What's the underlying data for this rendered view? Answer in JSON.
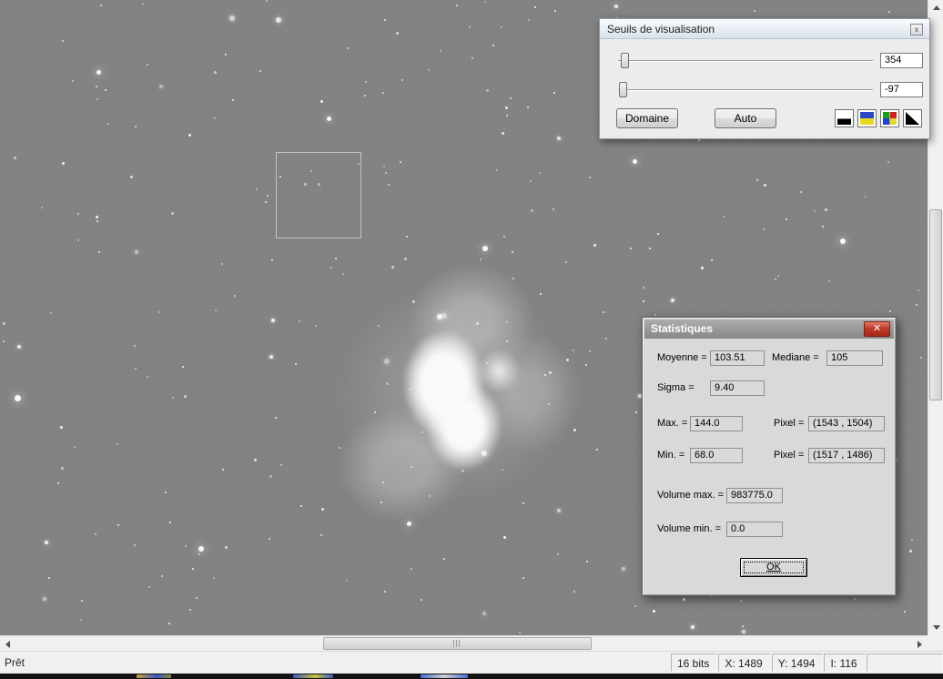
{
  "status": {
    "ready": "Prêt",
    "cells": [
      "16 bits",
      "X: 1489",
      "Y: 1494",
      "I: 116"
    ]
  },
  "seuils": {
    "title": "Seuils de visualisation",
    "high_value": "354",
    "low_value": "-97",
    "domaine_label": "Domaine",
    "auto_label": "Auto",
    "mini_button_glyph": "x"
  },
  "stats": {
    "title": "Statistiques",
    "close_glyph": "✕",
    "moyenne_label": "Moyenne =",
    "moyenne_value": "103.51",
    "mediane_label": "Mediane =",
    "mediane_value": "105",
    "sigma_label": "Sigma =",
    "sigma_value": "9.40",
    "max_label": "Max. =",
    "max_value": "144.0",
    "max_pixel_label": "Pixel =",
    "max_pixel_value": "(1543 , 1504)",
    "min_label": "Min. =",
    "min_value": "68.0",
    "min_pixel_label": "Pixel =",
    "min_pixel_value": "(1517 , 1486)",
    "volume_max_label": "Volume max. =",
    "volume_max_value": "983775.0",
    "volume_min_label": "Volume min. =",
    "volume_min_value": "0.0",
    "ok_label": "OK"
  }
}
